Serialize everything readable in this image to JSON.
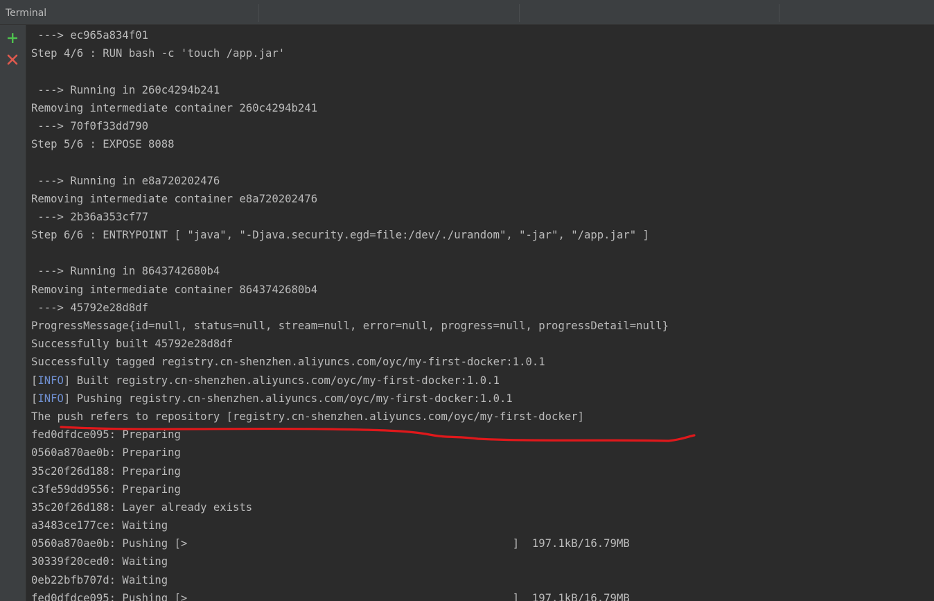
{
  "window": {
    "title": "Terminal"
  },
  "toolbar": {
    "new_session_icon": "plus-icon",
    "close_session_icon": "close-icon",
    "add_color": "#4ec24e",
    "close_color": "#e05a4f"
  },
  "annotation": {
    "color": "#e0181b"
  },
  "terminal": {
    "lines": [
      {
        "text": " ---> ec965a834f01"
      },
      {
        "text": "Step 4/6 : RUN bash -c 'touch /app.jar'"
      },
      {
        "text": ""
      },
      {
        "text": " ---> Running in 260c4294b241"
      },
      {
        "text": "Removing intermediate container 260c4294b241"
      },
      {
        "text": " ---> 70f0f33dd790"
      },
      {
        "text": "Step 5/6 : EXPOSE 8088"
      },
      {
        "text": ""
      },
      {
        "text": " ---> Running in e8a720202476"
      },
      {
        "text": "Removing intermediate container e8a720202476"
      },
      {
        "text": " ---> 2b36a353cf77"
      },
      {
        "text": "Step 6/6 : ENTRYPOINT [ \"java\", \"-Djava.security.egd=file:/dev/./urandom\", \"-jar\", \"/app.jar\" ]"
      },
      {
        "text": ""
      },
      {
        "text": " ---> Running in 8643742680b4"
      },
      {
        "text": "Removing intermediate container 8643742680b4"
      },
      {
        "text": " ---> 45792e28d8df"
      },
      {
        "text": "ProgressMessage{id=null, status=null, stream=null, error=null, progress=null, progressDetail=null}"
      },
      {
        "text": "Successfully built 45792e28d8df"
      },
      {
        "text": "Successfully tagged registry.cn-shenzhen.aliyuncs.com/oyc/my-first-docker:1.0.1"
      },
      {
        "prefix": "[",
        "tag": "INFO",
        "text": "] Built registry.cn-shenzhen.aliyuncs.com/oyc/my-first-docker:1.0.1"
      },
      {
        "prefix": "[",
        "tag": "INFO",
        "text": "] Pushing registry.cn-shenzhen.aliyuncs.com/oyc/my-first-docker:1.0.1"
      },
      {
        "text": "The push refers to repository [registry.cn-shenzhen.aliyuncs.com/oyc/my-first-docker]"
      },
      {
        "text": "fed0dfdce095: Preparing"
      },
      {
        "text": "0560a870ae0b: Preparing"
      },
      {
        "text": "35c20f26d188: Preparing"
      },
      {
        "text": "c3fe59dd9556: Preparing"
      },
      {
        "text": "35c20f26d188: Layer already exists"
      },
      {
        "text": "a3483ce177ce: Waiting"
      },
      {
        "text": "0560a870ae0b: Pushing [>                                                  ]  197.1kB/16.79MB"
      },
      {
        "text": "30339f20ced0: Waiting"
      },
      {
        "text": "0eb22bfb707d: Waiting"
      },
      {
        "text": "fed0dfdce095: Pushing [>                                                  ]  197.1kB/16.79MB"
      }
    ]
  }
}
